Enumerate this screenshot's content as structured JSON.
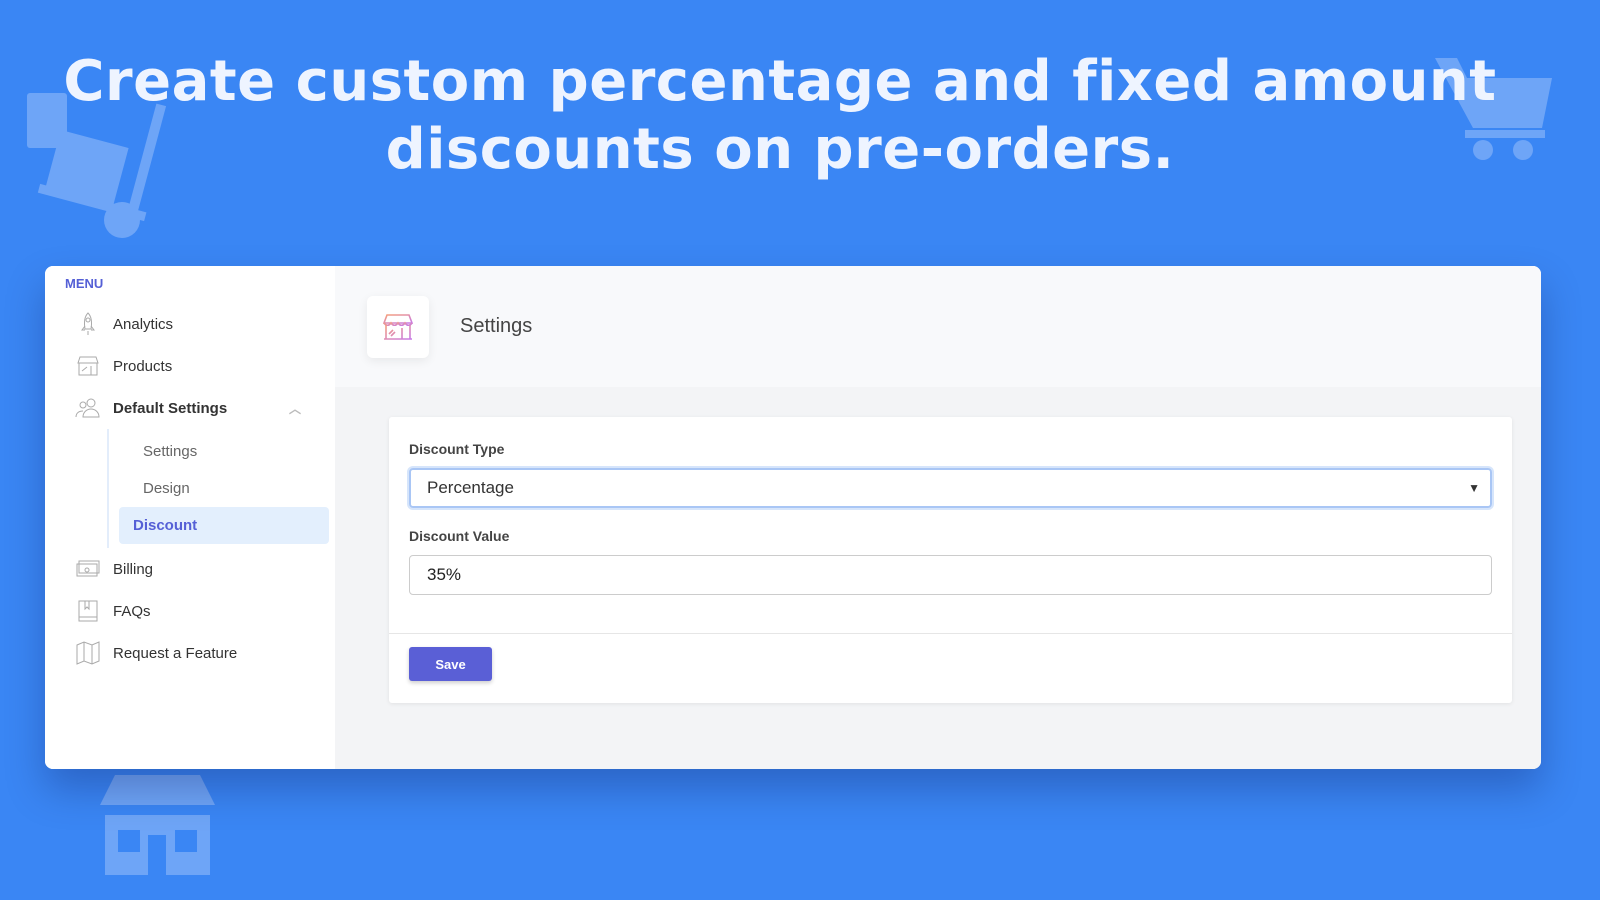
{
  "headline": {
    "line1": "Create custom percentage and fixed amount",
    "line2": "discounts on pre-orders."
  },
  "sidebar": {
    "menu_label": "MENU",
    "items": [
      {
        "label": "Analytics",
        "icon": "rocket-icon"
      },
      {
        "label": "Products",
        "icon": "store-icon"
      },
      {
        "label": "Default Settings",
        "icon": "users-icon",
        "expanded": true
      },
      {
        "label": "Billing",
        "icon": "money-icon"
      },
      {
        "label": "FAQs",
        "icon": "book-icon"
      },
      {
        "label": "Request a Feature",
        "icon": "map-icon"
      }
    ],
    "sub_items": [
      {
        "label": "Settings"
      },
      {
        "label": "Design"
      },
      {
        "label": "Discount",
        "active": true
      }
    ]
  },
  "header": {
    "title": "Settings",
    "icon": "store-icon"
  },
  "form": {
    "discount_type_label": "Discount Type",
    "discount_type_value": "Percentage",
    "discount_value_label": "Discount Value",
    "discount_value": "35%",
    "save_label": "Save"
  },
  "colors": {
    "background": "#3a86f4",
    "accent": "#5a5fd6",
    "active_bg": "#e3effd"
  }
}
